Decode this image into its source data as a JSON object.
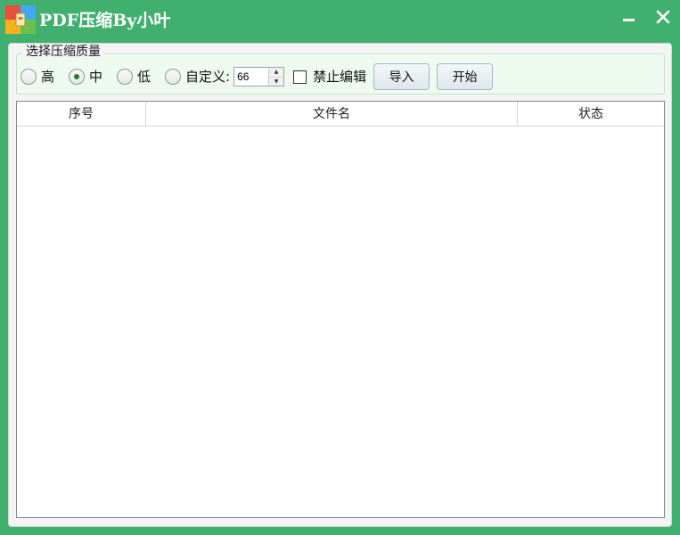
{
  "window": {
    "title": "PDF压缩By小叶",
    "minimize_symbol": "—",
    "close_symbol": "✕",
    "app_icon": "archive-icon",
    "accent_color": "#41b06e"
  },
  "quality_group": {
    "legend": "选择压缩质量",
    "options": [
      {
        "label": "高",
        "checked": false
      },
      {
        "label": "中",
        "checked": true
      },
      {
        "label": "低",
        "checked": false
      },
      {
        "label": "自定义:",
        "checked": false
      }
    ],
    "custom_value": "66",
    "disable_edit_label": "禁止编辑",
    "disable_edit_checked": false,
    "import_label": "导入",
    "start_label": "开始"
  },
  "file_list": {
    "columns": [
      "序号",
      "文件名",
      "状态"
    ],
    "rows": []
  }
}
